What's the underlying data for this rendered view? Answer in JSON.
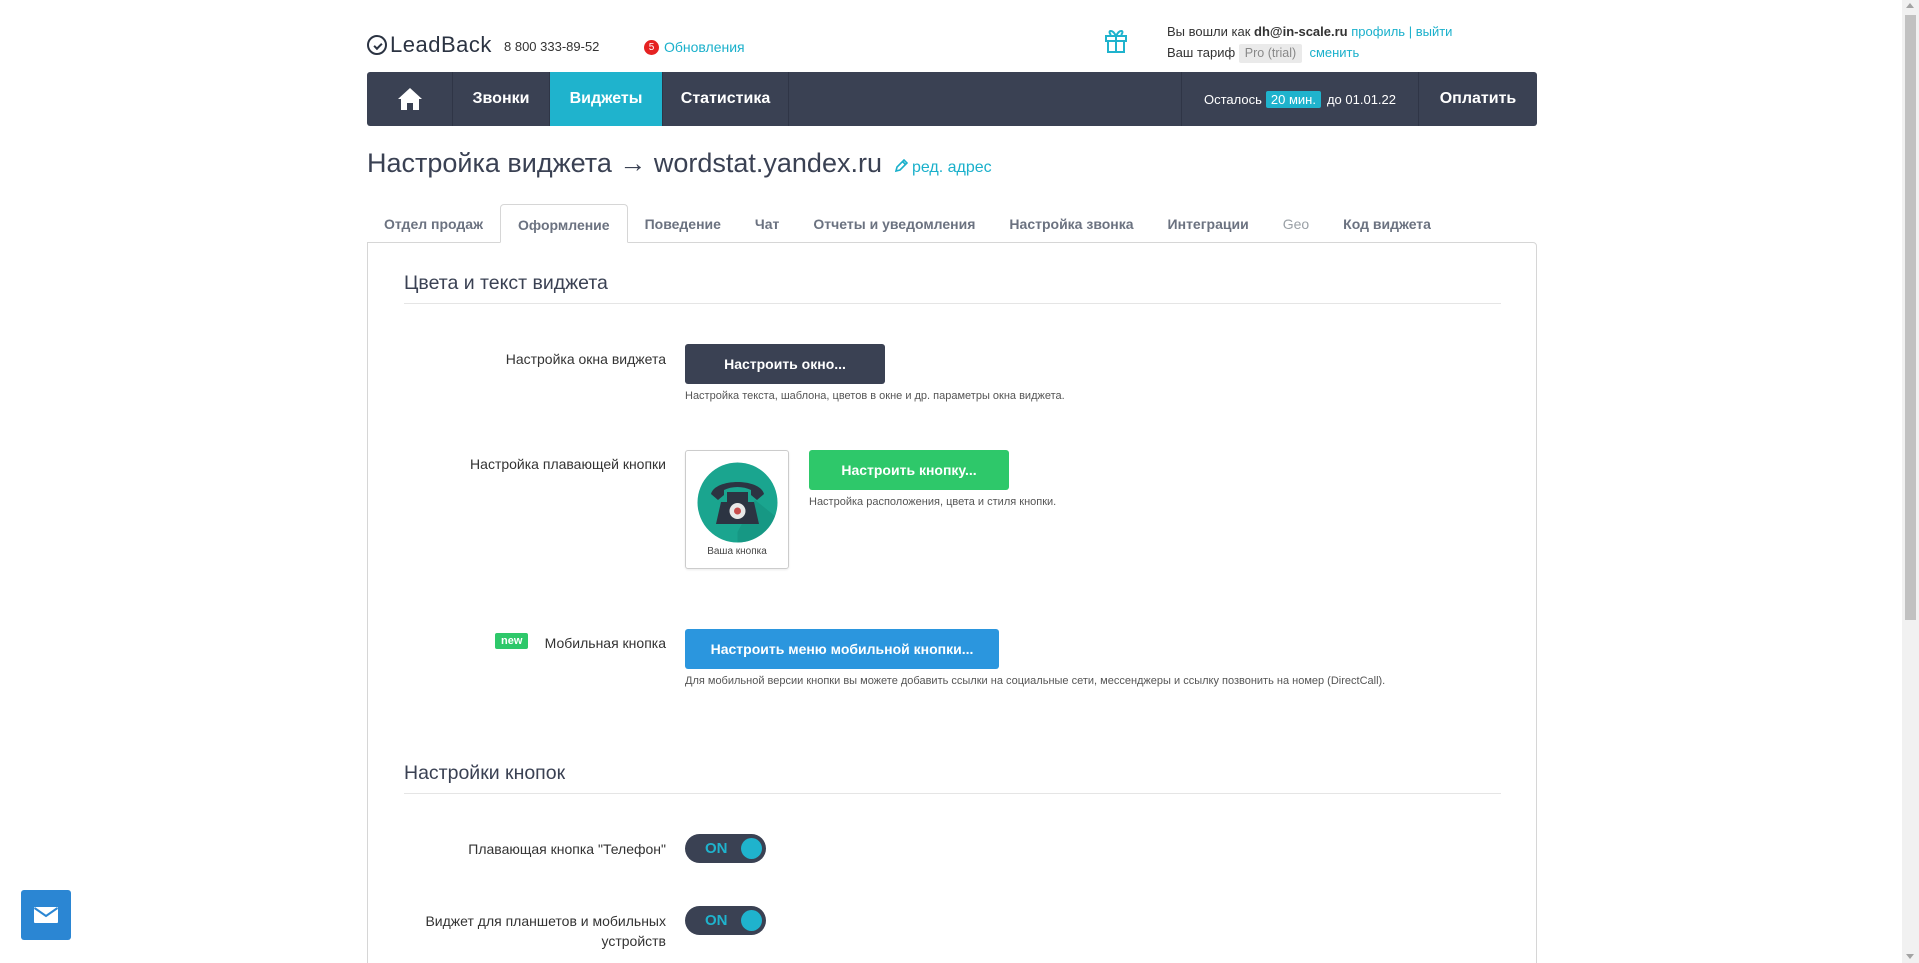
{
  "header": {
    "logo": "LeadBack",
    "phone": "8 800 333-89-52",
    "updates_count": "5",
    "updates_label": "Обновления",
    "logged_in_prefix": "Вы вошли как",
    "user_email": "dh@in-scale.ru",
    "profile_link": "профиль",
    "separator": "|",
    "logout_link": "выйти",
    "tariff_prefix": "Ваш тариф",
    "tariff": "Pro (trial)",
    "change_link": "сменить"
  },
  "nav": {
    "calls": "Звонки",
    "widgets": "Виджеты",
    "stats": "Статистика",
    "remain_prefix": "Осталось",
    "remain_value": "20 мин.",
    "remain_until": "до",
    "remain_date": "01.01.22",
    "pay": "Оплатить"
  },
  "page": {
    "title": "Настройка виджета → wordstat.yandex.ru",
    "edit_link": "ред. адрес"
  },
  "tabs": [
    {
      "label": "Отдел продаж"
    },
    {
      "label": "Оформление"
    },
    {
      "label": "Поведение"
    },
    {
      "label": "Чат"
    },
    {
      "label": "Отчеты и уведомления"
    },
    {
      "label": "Настройка звонка"
    },
    {
      "label": "Интеграции"
    },
    {
      "label": "Geo"
    },
    {
      "label": "Код виджета"
    }
  ],
  "active_tab": "Оформление",
  "section1": {
    "title": "Цвета и текст виджета",
    "window_label": "Настройка окна виджета",
    "window_button": "Настроить окно...",
    "window_hint": "Настройка текста, шаблона, цветов в окне и др. параметры окна виджета.",
    "float_label": "Настройка плавающей кнопки",
    "float_preview_caption": "Ваша кнопка",
    "float_button": "Настроить кнопку...",
    "float_hint": "Настройка расположения, цвета и стиля кнопки.",
    "mobile_badge": "new",
    "mobile_label": "Мобильная кнопка",
    "mobile_button": "Настроить меню мобильной кнопки...",
    "mobile_hint": "Для мобильной версии кнопки вы можете добавить ссылки на социальные сети, мессенджеры и ссылку позвонить на номер (DirectCall)."
  },
  "section2": {
    "title": "Настройки кнопок",
    "phone_float_label": "Плавающая кнопка \"Телефон\"",
    "phone_float_state": "ON",
    "tablet_label_line1": "Виджет для планшетов и мобильных",
    "tablet_label_line2": "устройств",
    "tablet_state": "ON"
  },
  "colors": {
    "nav_bg": "#3a4153",
    "accent": "#1fb3cd",
    "green": "#2ec86a",
    "blue": "#2b96de",
    "badge_red": "#e52222"
  },
  "icons": {
    "home": "home-icon",
    "gift": "gift-icon",
    "pencil": "pencil-icon",
    "phone": "telephone-icon",
    "mail": "envelope-icon"
  }
}
